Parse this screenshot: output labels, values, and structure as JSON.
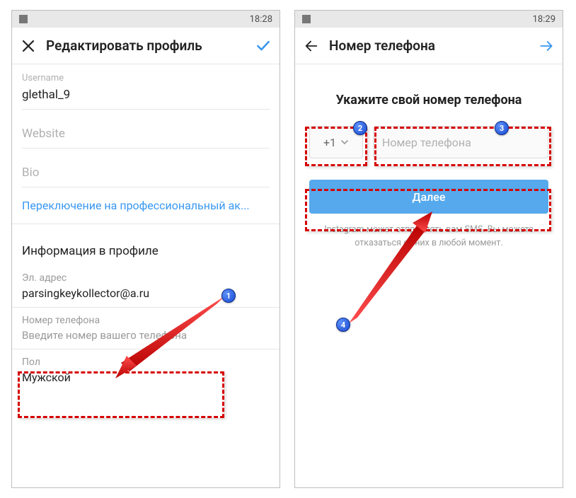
{
  "left": {
    "status": {
      "time": "18:28"
    },
    "nav": {
      "title": "Редактировать профиль"
    },
    "fields": {
      "username_label": "Username",
      "username_value": "glethal_9",
      "website_label": "Website",
      "bio_label": "Bio"
    },
    "pro_link": "Переключение на профессиональный ак...",
    "profile_info_title": "Информация в профиле",
    "email": {
      "label": "Эл. адрес",
      "value": "parsingkeykollector@a.ru"
    },
    "phone": {
      "label": "Номер телефона",
      "placeholder": "Введите номер вашего телефона"
    },
    "gender": {
      "label": "Пол",
      "value": "Мужской"
    }
  },
  "right": {
    "status": {
      "time": "18:29"
    },
    "nav": {
      "title": "Номер телефона"
    },
    "heading": "Укажите свой номер телефона",
    "cc": "+1",
    "phone_placeholder": "Номер телефона",
    "next": "Далее",
    "sms_hint": "Instagram может отправлять вам SMS. Вы можете отказаться от них в любой момент."
  },
  "badges": {
    "b1": "1",
    "b2": "2",
    "b3": "3",
    "b4": "4"
  }
}
